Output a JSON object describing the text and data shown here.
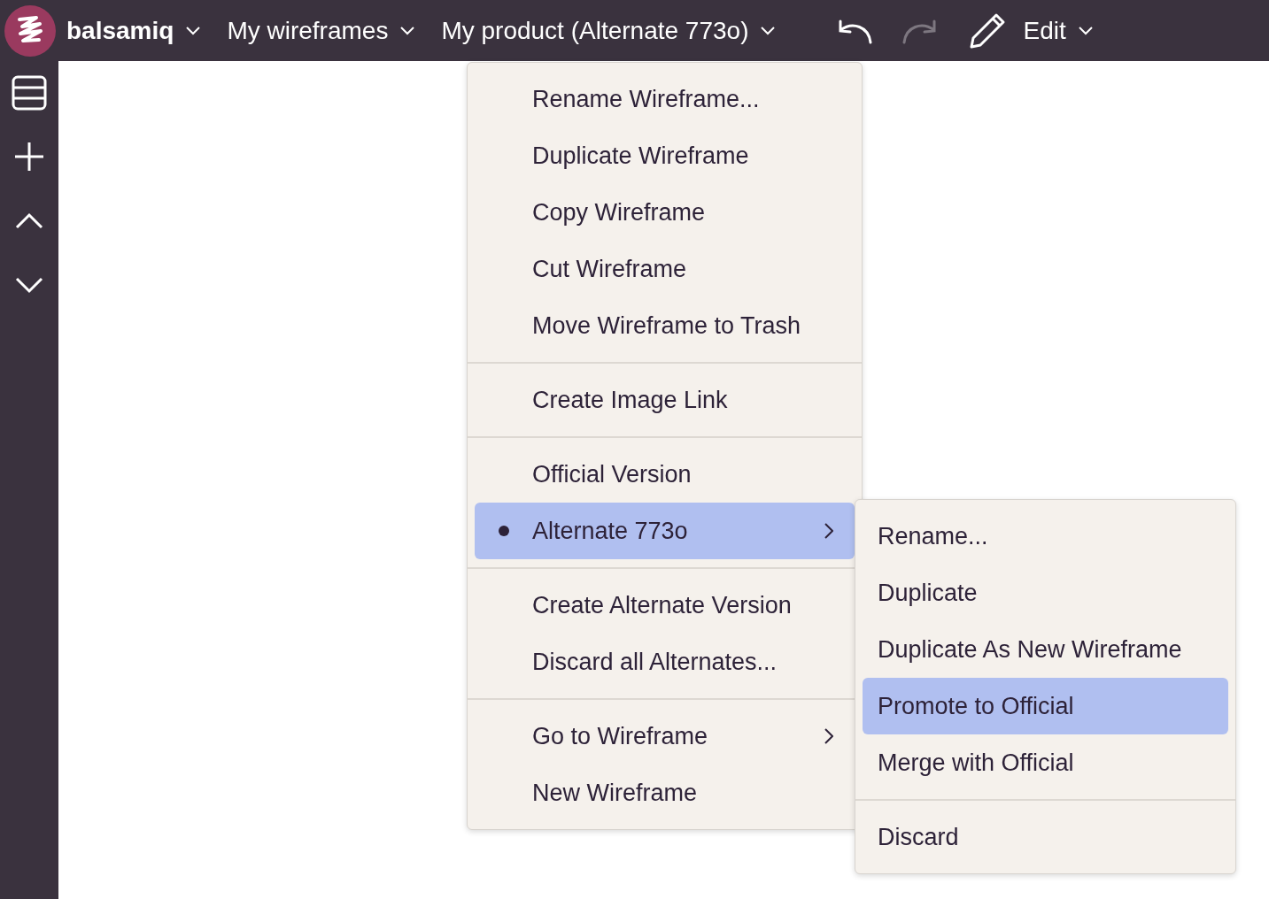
{
  "top_bar": {
    "brand": "balsamiq",
    "breadcrumbs": [
      {
        "label": "My wireframes"
      },
      {
        "label": "My product (Alternate 773o)"
      }
    ],
    "undo": {
      "disabled": false
    },
    "redo": {
      "disabled": true
    },
    "edit": {
      "label": "Edit"
    }
  },
  "menu": {
    "sections": [
      [
        {
          "label": "Rename Wireframe...",
          "selected": false,
          "submenu": false,
          "checked": false
        },
        {
          "label": "Duplicate Wireframe",
          "selected": false,
          "submenu": false,
          "checked": false
        },
        {
          "label": "Copy Wireframe",
          "selected": false,
          "submenu": false,
          "checked": false
        },
        {
          "label": "Cut Wireframe",
          "selected": false,
          "submenu": false,
          "checked": false
        },
        {
          "label": "Move Wireframe to Trash",
          "selected": false,
          "submenu": false,
          "checked": false
        }
      ],
      [
        {
          "label": "Create Image Link",
          "selected": false,
          "submenu": false,
          "checked": false
        }
      ],
      [
        {
          "label": "Official Version",
          "selected": false,
          "submenu": false,
          "checked": false
        },
        {
          "label": "Alternate 773o",
          "selected": true,
          "submenu": true,
          "checked": true
        }
      ],
      [
        {
          "label": "Create Alternate Version",
          "selected": false,
          "submenu": false,
          "checked": false
        },
        {
          "label": "Discard all Alternates...",
          "selected": false,
          "submenu": false,
          "checked": false
        }
      ],
      [
        {
          "label": "Go to Wireframe",
          "selected": false,
          "submenu": true,
          "checked": false
        },
        {
          "label": "New Wireframe",
          "selected": false,
          "submenu": false,
          "checked": false
        }
      ]
    ]
  },
  "submenu": {
    "sections": [
      [
        {
          "label": "Rename...",
          "selected": false
        },
        {
          "label": "Duplicate",
          "selected": false
        },
        {
          "label": "Duplicate As New Wireframe",
          "selected": false
        },
        {
          "label": "Promote to Official",
          "selected": true
        },
        {
          "label": "Merge with Official",
          "selected": false
        }
      ],
      [
        {
          "label": "Discard",
          "selected": false
        }
      ]
    ]
  }
}
